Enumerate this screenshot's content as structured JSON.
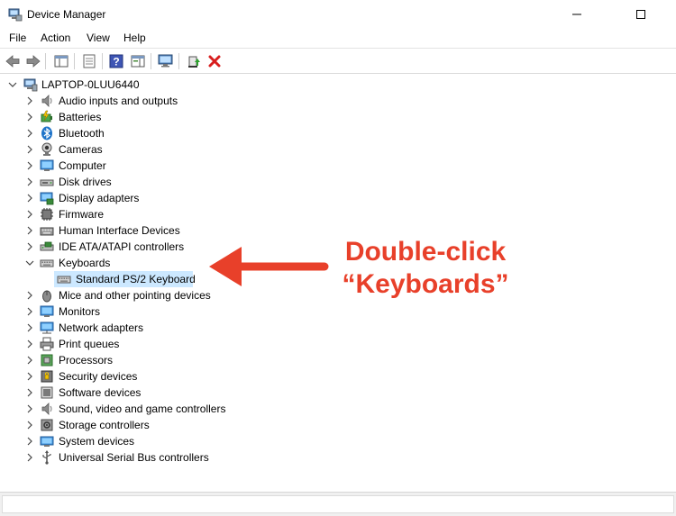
{
  "window": {
    "title": "Device Manager"
  },
  "menu": [
    "File",
    "Action",
    "View",
    "Help"
  ],
  "tree": {
    "root": "LAPTOP-0LUU6440",
    "categories": [
      {
        "label": "Audio inputs and outputs",
        "icon": "speaker-icon"
      },
      {
        "label": "Batteries",
        "icon": "battery-icon"
      },
      {
        "label": "Bluetooth",
        "icon": "bluetooth-icon"
      },
      {
        "label": "Cameras",
        "icon": "camera-icon"
      },
      {
        "label": "Computer",
        "icon": "computer-icon"
      },
      {
        "label": "Disk drives",
        "icon": "disk-drive-icon"
      },
      {
        "label": "Display adapters",
        "icon": "display-adapter-icon"
      },
      {
        "label": "Firmware",
        "icon": "firmware-icon"
      },
      {
        "label": "Human Interface Devices",
        "icon": "hid-icon"
      },
      {
        "label": "IDE ATA/ATAPI controllers",
        "icon": "ide-controller-icon"
      },
      {
        "label": "Keyboards",
        "icon": "keyboard-icon",
        "expanded": true
      },
      {
        "label": "Mice and other pointing devices",
        "icon": "mouse-icon"
      },
      {
        "label": "Monitors",
        "icon": "monitor-icon"
      },
      {
        "label": "Network adapters",
        "icon": "network-adapter-icon"
      },
      {
        "label": "Print queues",
        "icon": "printer-icon"
      },
      {
        "label": "Processors",
        "icon": "processor-icon"
      },
      {
        "label": "Security devices",
        "icon": "security-device-icon"
      },
      {
        "label": "Software devices",
        "icon": "software-device-icon"
      },
      {
        "label": "Sound, video and game controllers",
        "icon": "sound-icon"
      },
      {
        "label": "Storage controllers",
        "icon": "storage-controller-icon"
      },
      {
        "label": "System devices",
        "icon": "system-device-icon"
      },
      {
        "label": "Universal Serial Bus controllers",
        "icon": "usb-icon"
      }
    ],
    "keyboard_child": "Standard PS/2 Keyboard"
  },
  "annotation": {
    "line1": "Double-click",
    "line2": "“Keyboards”"
  },
  "colors": {
    "annotation": "#e8402a",
    "selection": "#cce8ff"
  }
}
